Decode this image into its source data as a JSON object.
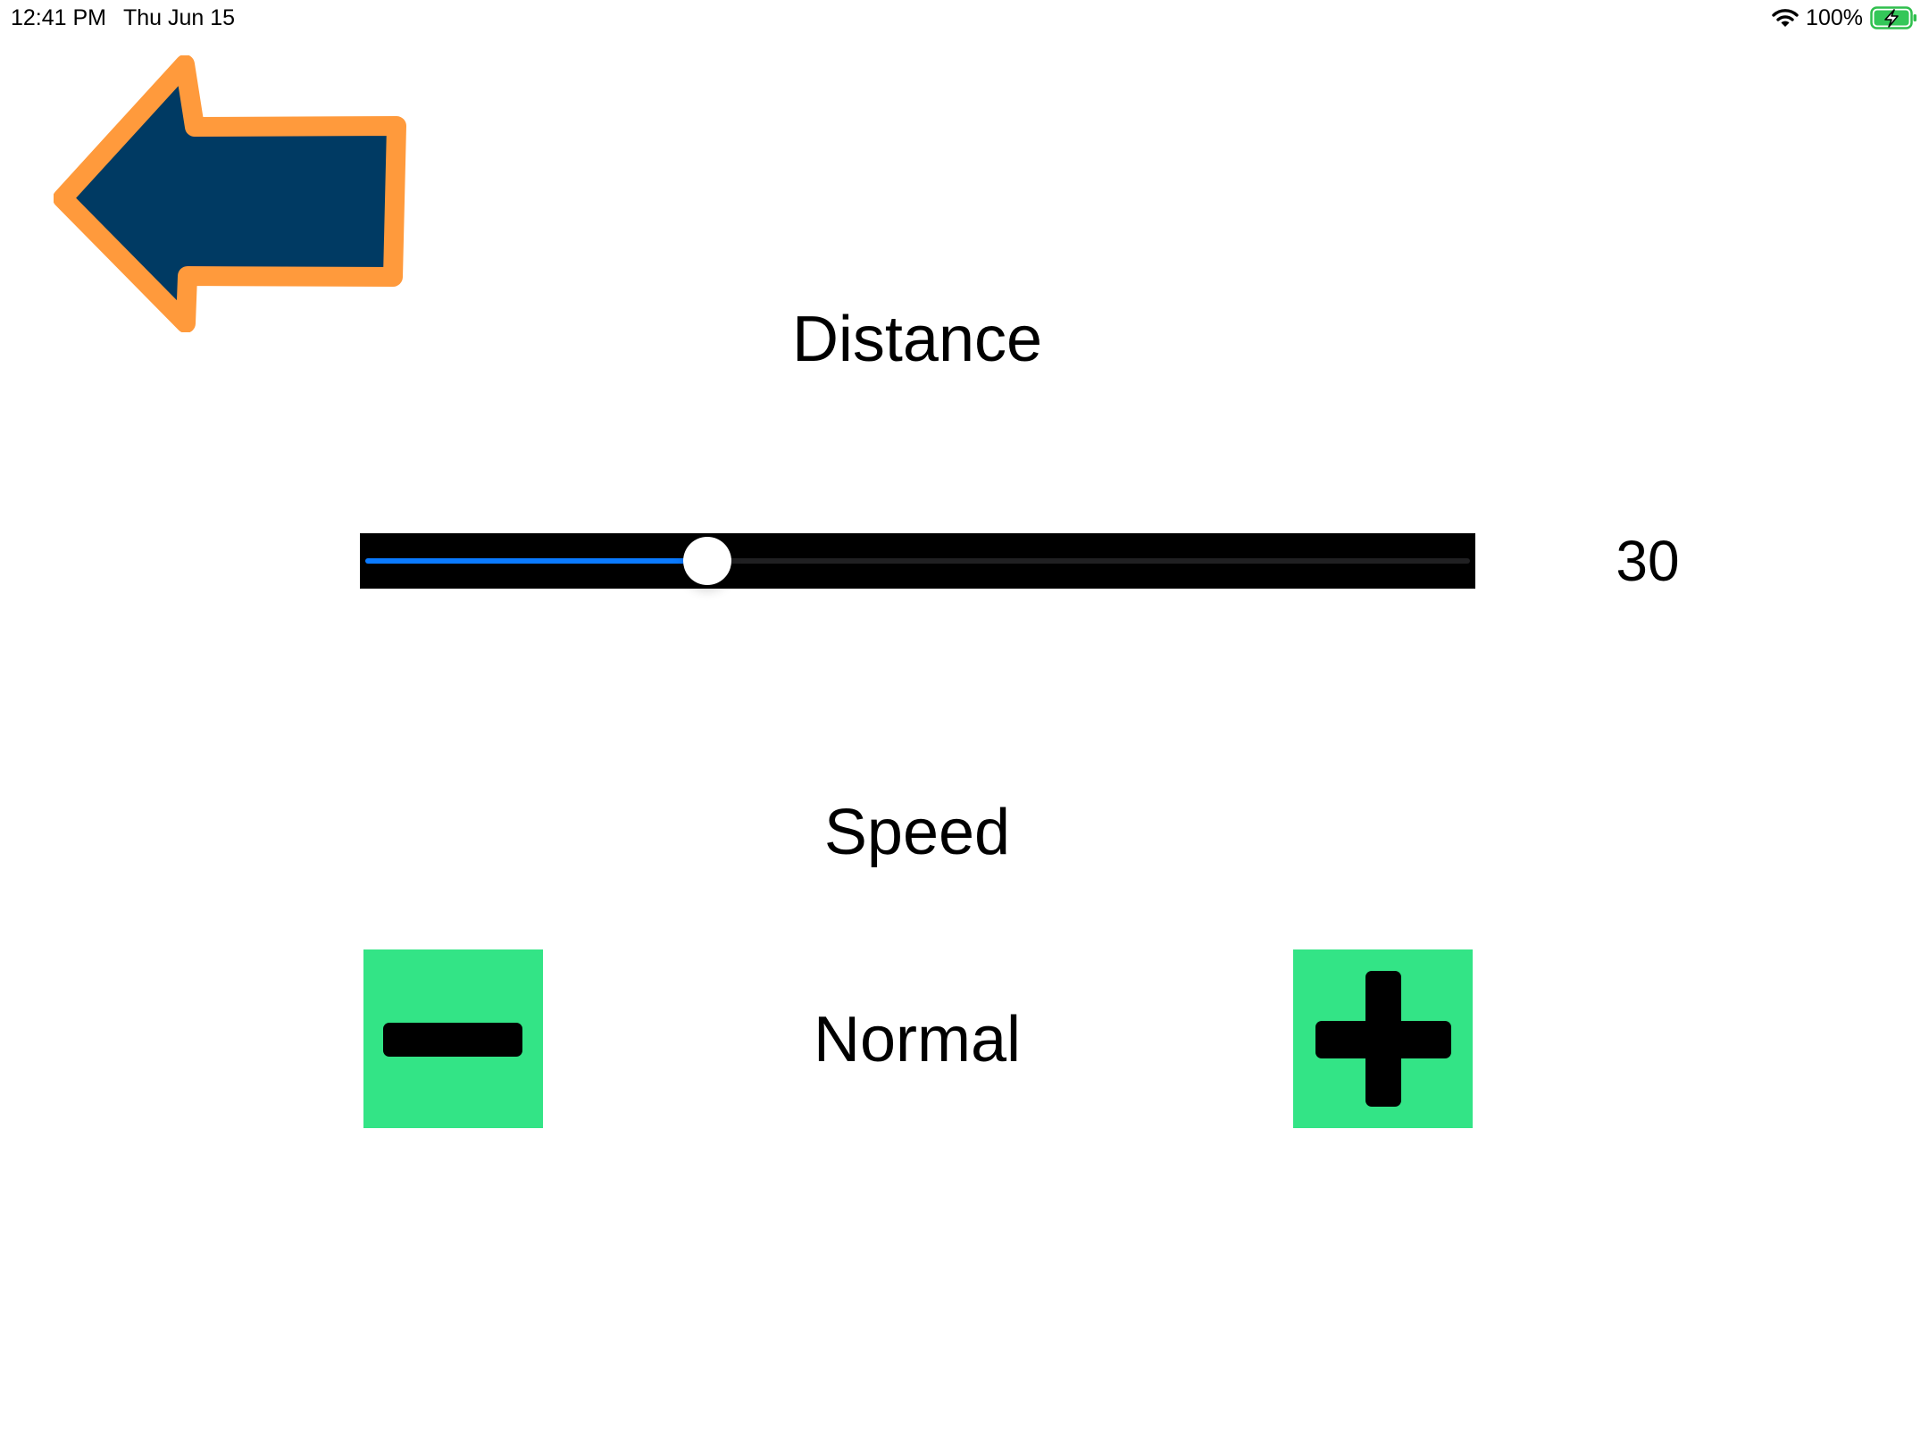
{
  "status_bar": {
    "time": "12:41 PM",
    "date": "Thu Jun 15",
    "battery_percent": "100%",
    "battery_level": 1.0,
    "wifi_icon": "wifi-icon",
    "battery_icon": "battery-charging-icon"
  },
  "back_button": {
    "icon": "back-arrow-icon",
    "fill_color": "#003a63",
    "stroke_color": "#ff9a3c"
  },
  "distance": {
    "title": "Distance",
    "value": "30",
    "slider_fraction": 0.31,
    "fill_color": "#0a7aff"
  },
  "speed": {
    "title": "Speed",
    "value": "Normal",
    "decrease_icon": "minus-icon",
    "increase_icon": "plus-icon",
    "button_color": "#33e486"
  }
}
